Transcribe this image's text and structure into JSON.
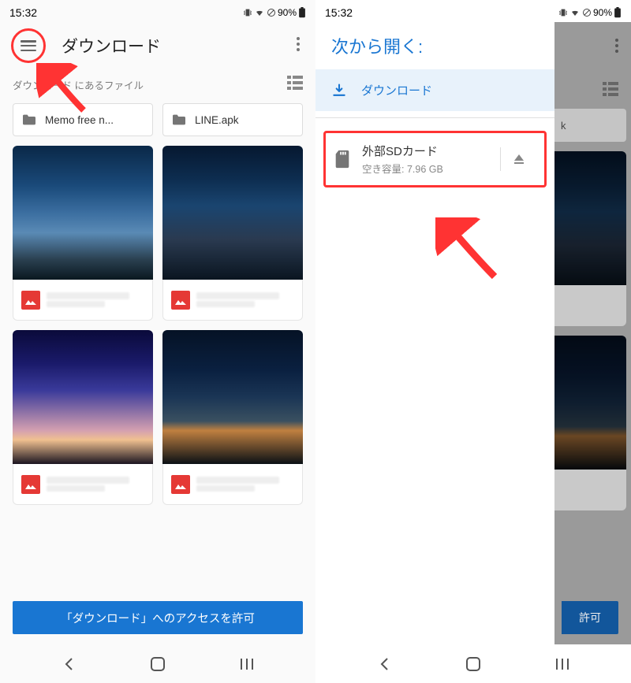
{
  "status": {
    "time": "15:32",
    "battery": "90%"
  },
  "left": {
    "title": "ダウンロード",
    "subtitle": "ダウンロード にあるファイル",
    "folders": [
      {
        "label": "Memo free n..."
      },
      {
        "label": "LINE.apk"
      }
    ],
    "access_button": "「ダウンロード」へのアクセスを許可"
  },
  "right": {
    "drawer_title": "次から開く:",
    "download_label": "ダウンロード",
    "sd_title": "外部SDカード",
    "sd_free": "空き容量: 7.96 GB",
    "folder_peek": "k",
    "access_peek": "許可"
  }
}
